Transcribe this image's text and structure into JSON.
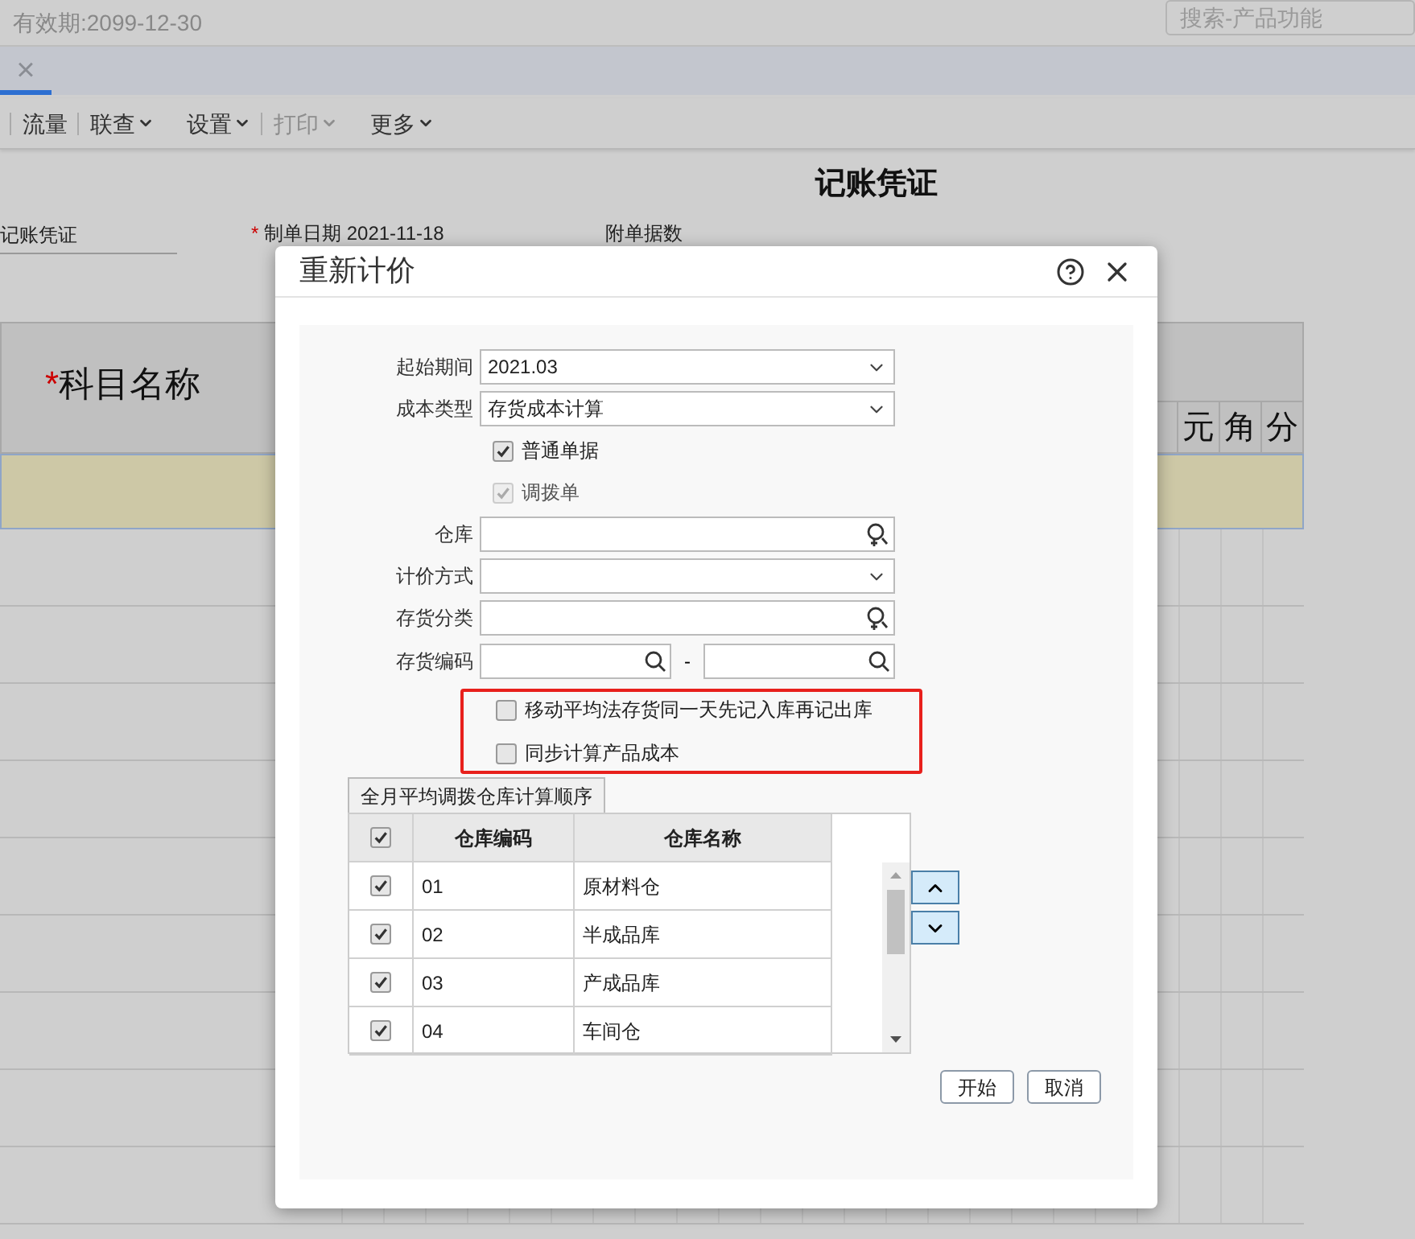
{
  "top_bar": {
    "validity": "有效期:2099-12-30",
    "search_placeholder": "搜索-产品功能"
  },
  "tab_close": "×",
  "toolbar": [
    {
      "label": "流量",
      "separator_before": true,
      "dropdown": false,
      "disabled": false
    },
    {
      "label": "联查",
      "separator_before": true,
      "dropdown": true,
      "disabled": false
    },
    {
      "label": "设置",
      "separator_before": false,
      "dropdown": true,
      "disabled": false
    },
    {
      "label": "打印",
      "separator_before": true,
      "dropdown": true,
      "disabled": true
    },
    {
      "label": "更多",
      "separator_before": false,
      "dropdown": true,
      "disabled": false
    }
  ],
  "voucher": {
    "title": "记账凭证",
    "type_value": "记账凭证",
    "required_mark": "*",
    "date_label": "制单日期",
    "date": "2021-11-18",
    "attachments_label": "附单据数",
    "subject_required_mark": "*",
    "subject_header": "科目名称",
    "amount_units": [
      "元",
      "角",
      "分"
    ]
  },
  "dialog": {
    "title": "重新计价",
    "form": [
      {
        "kind": "select",
        "label": "起始期间",
        "value": "2021.03"
      },
      {
        "kind": "select",
        "label": "成本类型",
        "value": "存货成本计算"
      },
      {
        "kind": "checkbox",
        "label": "普通单据",
        "checked": true,
        "disabled": false
      },
      {
        "kind": "checkbox",
        "label": "调拨单",
        "checked": true,
        "disabled": true
      },
      {
        "kind": "lookup",
        "label": "仓库"
      },
      {
        "kind": "select",
        "label": "计价方式"
      },
      {
        "kind": "lookup",
        "label": "存货分类"
      },
      {
        "kind": "range",
        "label": "存货编码",
        "separator": "-"
      }
    ],
    "highlighted_options": [
      {
        "label": "移动平均法存货同一天先记入库再记出库",
        "checked": false
      },
      {
        "label": "同步计算产品成本",
        "checked": false
      }
    ],
    "tab": "全月平均调拨仓库计算顺序",
    "table": {
      "all_checked": true,
      "columns": [
        "仓库编码",
        "仓库名称"
      ],
      "rows": [
        {
          "checked": true,
          "code": "01",
          "name": "原材料仓"
        },
        {
          "checked": true,
          "code": "02",
          "name": "半成品库"
        },
        {
          "checked": true,
          "code": "03",
          "name": "产成品库"
        },
        {
          "checked": true,
          "code": "04",
          "name": "车间仓"
        }
      ]
    },
    "buttons": [
      "开始",
      "取消"
    ]
  }
}
